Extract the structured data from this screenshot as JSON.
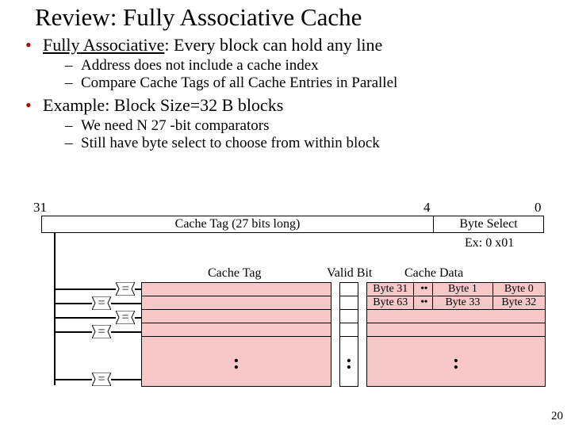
{
  "title": "Review: Fully Associative Cache",
  "bullets": {
    "b1": {
      "lead": "Fully Associative",
      "rest": ": Every block can hold any line"
    },
    "b1sub": [
      "Address does not include a cache index",
      "Compare Cache Tags of all Cache Entries in Parallel"
    ],
    "b2": "Example: Block Size=32 B blocks",
    "b2sub": [
      "We need N 27 -bit comparators",
      "Still have byte select to choose from within block"
    ]
  },
  "addr": {
    "bit_hi": "31",
    "bit_mid": "4",
    "bit_lo": "0",
    "tag_label": "Cache Tag (27 bits long)",
    "sel_label": "Byte Select",
    "sel_example": "Ex: 0 x01"
  },
  "cols": {
    "tag": "Cache Tag",
    "valid": "Valid Bit",
    "data": "Cache Data"
  },
  "cmp": "=",
  "data_rows": [
    {
      "c0": "Byte 31",
      "mid": "• •",
      "c1": "Byte 1",
      "c2": "Byte 0"
    },
    {
      "c0": "Byte 63",
      "mid": "• •",
      "c1": "Byte 33",
      "c2": "Byte 32"
    }
  ],
  "vdots": ":",
  "page": "20"
}
